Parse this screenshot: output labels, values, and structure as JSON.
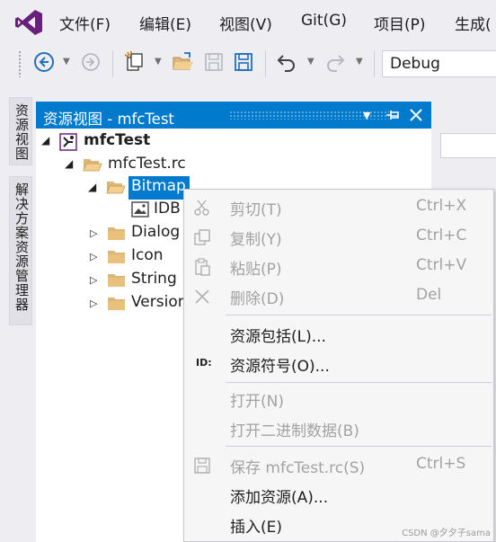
{
  "menubar": {
    "items": [
      "文件(F)",
      "编辑(E)",
      "视图(V)",
      "Git(G)",
      "项目(P)",
      "生成("
    ]
  },
  "toolbar": {
    "configuration": "Debug"
  },
  "side_tabs": [
    "资源视图",
    "解决方案资源管理器"
  ],
  "panel": {
    "title": "资源视图 - mfcTest"
  },
  "tree": {
    "root": "mfcTest",
    "rc_file": "mfcTest.rc",
    "bitmap_folder": "Bitmap",
    "bitmap_item": "IDB",
    "folders": [
      "Dialog",
      "Icon",
      "String",
      "Version"
    ]
  },
  "context_menu": {
    "items": [
      {
        "label": "剪切(T)",
        "shortcut": "Ctrl+X",
        "enabled": false,
        "icon": "scissors-icon"
      },
      {
        "label": "复制(Y)",
        "shortcut": "Ctrl+C",
        "enabled": false,
        "icon": "copy-icon"
      },
      {
        "label": "粘贴(P)",
        "shortcut": "Ctrl+V",
        "enabled": false,
        "icon": "paste-icon"
      },
      {
        "label": "删除(D)",
        "shortcut": "Del",
        "enabled": false,
        "icon": "delete-x-icon"
      },
      {
        "label": "资源包括(L)...",
        "shortcut": "",
        "enabled": true,
        "icon": ""
      },
      {
        "label": "资源符号(O)...",
        "shortcut": "",
        "enabled": true,
        "icon": "id-icon"
      },
      {
        "label": "打开(N)",
        "shortcut": "",
        "enabled": false,
        "icon": ""
      },
      {
        "label": "打开二进制数据(B)",
        "shortcut": "",
        "enabled": false,
        "icon": ""
      },
      {
        "label": "保存 mfcTest.rc(S)",
        "shortcut": "Ctrl+S",
        "enabled": false,
        "icon": "save-icon"
      },
      {
        "label": "添加资源(A)...",
        "shortcut": "",
        "enabled": true,
        "icon": ""
      },
      {
        "label": "插入(E)",
        "shortcut": "",
        "enabled": true,
        "icon": ""
      }
    ],
    "id_glyph": "ID:"
  },
  "watermark": "CSDN @夕夕子sama",
  "colors": {
    "accent": "#007acc",
    "vs_purple": "#68217a",
    "folder": "#dcb67a",
    "disabled_text": "#a2a2a2"
  }
}
